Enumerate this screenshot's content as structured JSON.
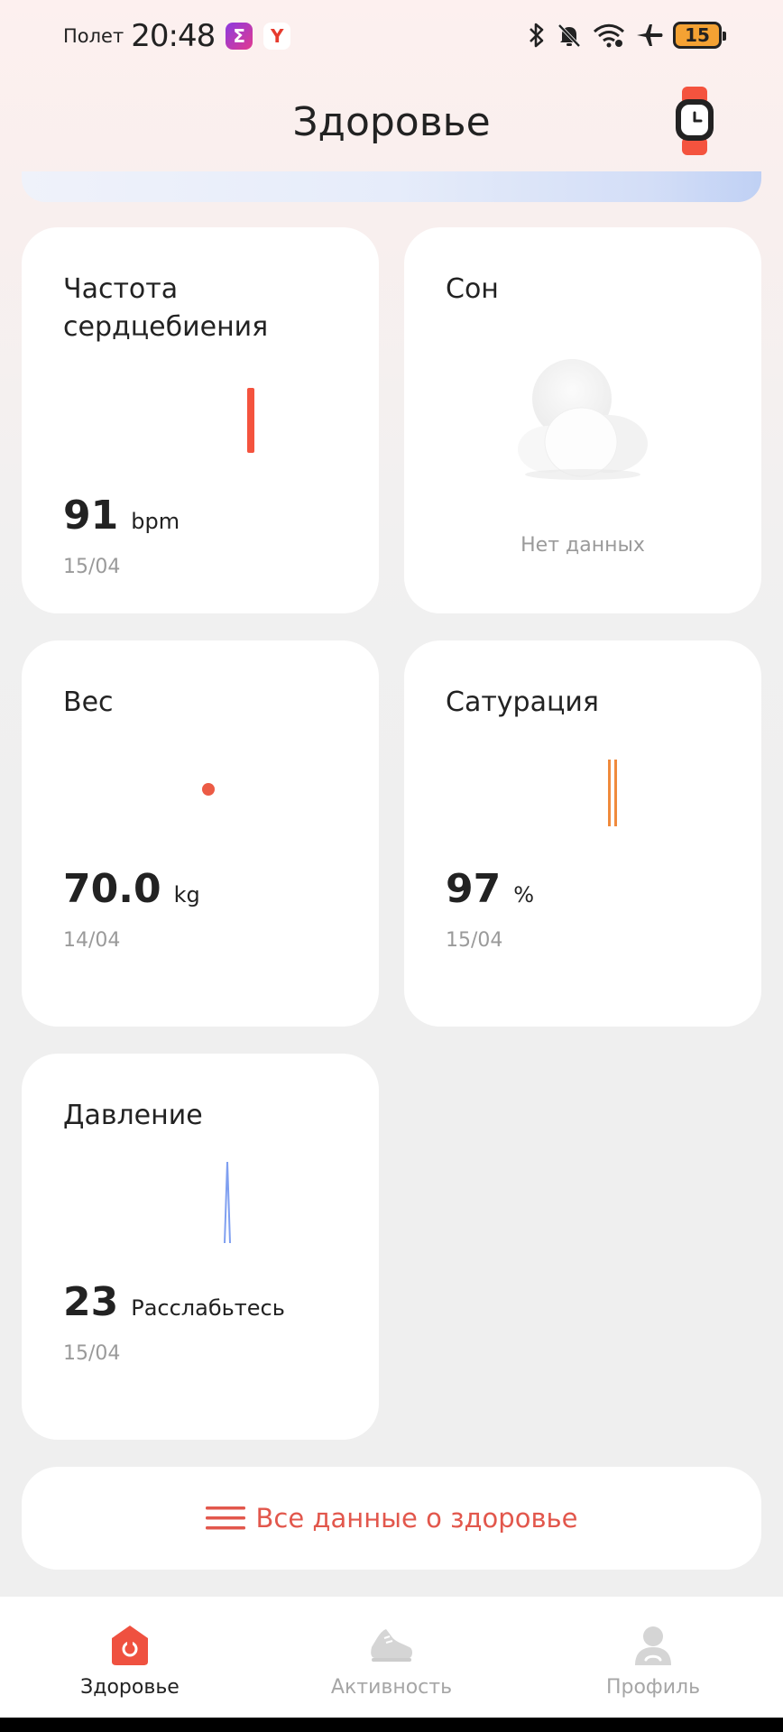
{
  "status_bar": {
    "carrier": "Полет",
    "time": "20:48",
    "battery": "15",
    "apps": [
      {
        "icon": "sigma-icon",
        "glyph": "Σ",
        "color": "#b434c8"
      },
      {
        "icon": "yandex-icon",
        "glyph": "Y",
        "color": "#e63b2e"
      }
    ]
  },
  "header": {
    "title": "Здоровье",
    "watch_icon": "smartwatch-icon"
  },
  "cards": {
    "heart_rate": {
      "title": "Частота сердцебиения",
      "value": "91",
      "unit": "bpm",
      "date": "15/04",
      "color": "#f4533e"
    },
    "sleep": {
      "title": "Сон",
      "empty_text": "Нет данных"
    },
    "weight": {
      "title": "Вес",
      "value": "70.0",
      "unit": "kg",
      "date": "14/04",
      "color": "#ec5b45"
    },
    "saturation": {
      "title": "Сатурация",
      "value": "97",
      "unit": "%",
      "date": "15/04",
      "color": "#f08a3c"
    },
    "pressure": {
      "title": "Давление",
      "value": "23",
      "unit": "Расслабьтесь",
      "date": "15/04",
      "color": "#7f9ff0"
    }
  },
  "all_data": {
    "label": "Все данные о здоровье",
    "icon": "menu-icon",
    "color": "#e2574c"
  },
  "bottom_nav": {
    "items": [
      {
        "label": "Здоровье",
        "icon": "health-icon",
        "active": true
      },
      {
        "label": "Активность",
        "icon": "shoe-icon",
        "active": false
      },
      {
        "label": "Профиль",
        "icon": "profile-icon",
        "active": false
      }
    ]
  }
}
